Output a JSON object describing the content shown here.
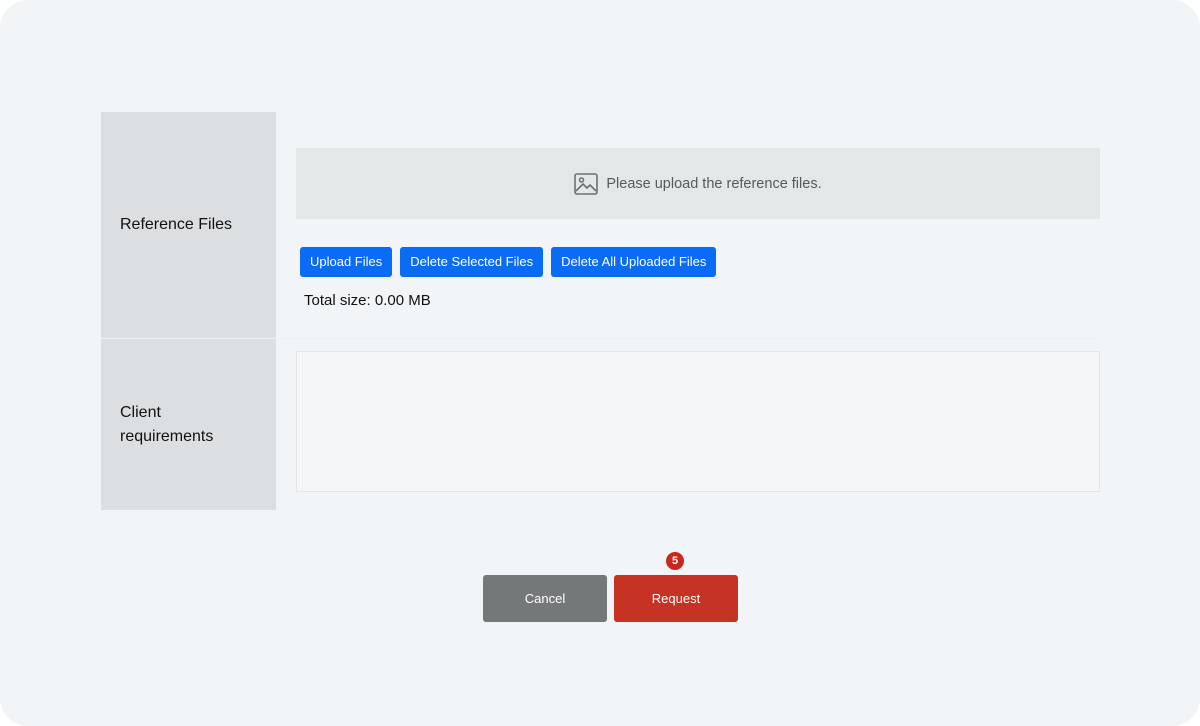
{
  "form": {
    "reference_files": {
      "label": "Reference Files",
      "dropzone_text": "Please upload the reference files.",
      "dropzone_icon": "image-icon",
      "upload_button": "Upload Files",
      "delete_selected_button": "Delete Selected Files",
      "delete_all_button": "Delete All Uploaded Files",
      "total_size": "Total size: 0.00 MB"
    },
    "client_requirements": {
      "label": "Client requirements",
      "value": ""
    }
  },
  "actions": {
    "cancel_label": "Cancel",
    "request_label": "Request",
    "step_badge": "5"
  },
  "colors": {
    "primary_blue": "#0a6cf5",
    "request_red": "#c73322",
    "cancel_gray": "#747879",
    "label_bg": "#dcdfe1",
    "page_bg": "#f2f5f7"
  }
}
